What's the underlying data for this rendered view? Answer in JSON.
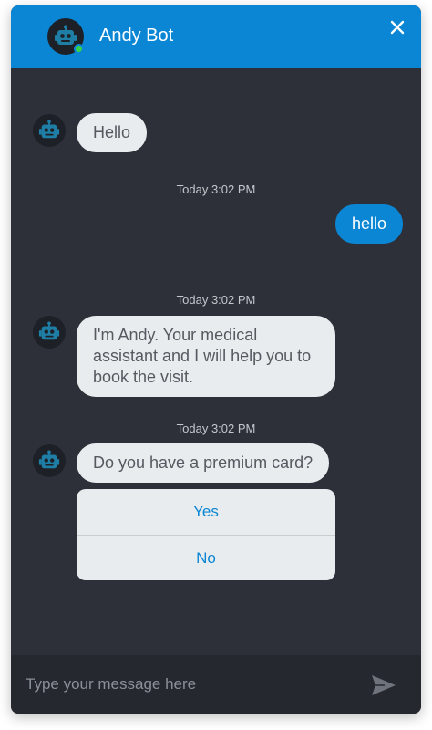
{
  "header": {
    "title": "Andy Bot",
    "avatar_icon": "robot-icon",
    "status": "online",
    "close_icon": "close-icon"
  },
  "messages": [
    {
      "from": "bot",
      "text": "Hello"
    },
    {
      "timestamp": "Today 3:02 PM"
    },
    {
      "from": "user",
      "text": "hello"
    },
    {
      "timestamp": "Today 3:02 PM"
    },
    {
      "from": "bot",
      "text": "I'm Andy. Your medical assistant and I will help you to book the visit."
    },
    {
      "timestamp": "Today 3:02 PM"
    },
    {
      "from": "bot",
      "text": "Do you have a premium card?"
    }
  ],
  "quick_replies": [
    "Yes",
    "No"
  ],
  "composer": {
    "placeholder": "Type your message here",
    "send_icon": "send-icon"
  },
  "colors": {
    "accent": "#0b86d4",
    "background": "#2d3038",
    "bubble": "#e9ecef",
    "online": "#36d34a"
  }
}
